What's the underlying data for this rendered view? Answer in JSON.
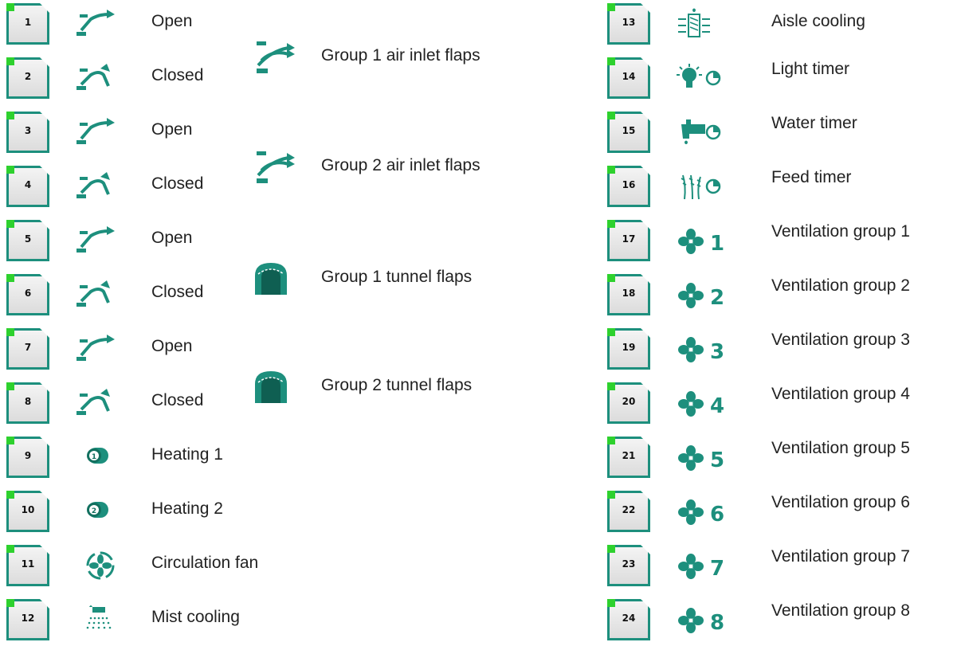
{
  "left_items": [
    {
      "num": "1",
      "label": "Open",
      "icon": "flap-open-icon"
    },
    {
      "num": "2",
      "label": "Closed",
      "icon": "flap-closed-icon"
    },
    {
      "num": "3",
      "label": "Open",
      "icon": "flap-open-icon"
    },
    {
      "num": "4",
      "label": "Closed",
      "icon": "flap-closed-icon"
    },
    {
      "num": "5",
      "label": "Open",
      "icon": "flap-open-icon"
    },
    {
      "num": "6",
      "label": "Closed",
      "icon": "flap-closed-icon"
    },
    {
      "num": "7",
      "label": "Open",
      "icon": "flap-open-icon"
    },
    {
      "num": "8",
      "label": "Closed",
      "icon": "flap-closed-icon"
    },
    {
      "num": "9",
      "label": "Heating 1",
      "icon": "heater-1-icon"
    },
    {
      "num": "10",
      "label": "Heating 2",
      "icon": "heater-2-icon"
    },
    {
      "num": "11",
      "label": "Circulation fan",
      "icon": "circulation-fan-icon"
    },
    {
      "num": "12",
      "label": "Mist cooling",
      "icon": "mist-cooling-icon"
    }
  ],
  "groups": [
    {
      "label": "Group 1 air inlet flaps",
      "icon": "air-inlet-flaps-icon"
    },
    {
      "label": "Group 2 air inlet flaps",
      "icon": "air-inlet-flaps-icon"
    },
    {
      "label": "Group 1 tunnel flaps",
      "icon": "tunnel-flaps-icon"
    },
    {
      "label": "Group 2 tunnel flaps",
      "icon": "tunnel-flaps-icon"
    }
  ],
  "right_items": [
    {
      "num": "13",
      "label": "Aisle cooling",
      "icon": "aisle-cooling-icon"
    },
    {
      "num": "14",
      "label": "Light timer",
      "icon": "light-timer-icon"
    },
    {
      "num": "15",
      "label": "Water timer",
      "icon": "water-timer-icon"
    },
    {
      "num": "16",
      "label": "Feed timer",
      "icon": "feed-timer-icon"
    },
    {
      "num": "17",
      "label": "Ventilation group 1",
      "icon": "fan-icon",
      "fan_number": "1"
    },
    {
      "num": "18",
      "label": "Ventilation group 2",
      "icon": "fan-icon",
      "fan_number": "2"
    },
    {
      "num": "19",
      "label": "Ventilation group 3",
      "icon": "fan-icon",
      "fan_number": "3"
    },
    {
      "num": "20",
      "label": "Ventilation group 4",
      "icon": "fan-icon",
      "fan_number": "4"
    },
    {
      "num": "21",
      "label": "Ventilation group 5",
      "icon": "fan-icon",
      "fan_number": "5"
    },
    {
      "num": "22",
      "label": "Ventilation group 6",
      "icon": "fan-icon",
      "fan_number": "6"
    },
    {
      "num": "23",
      "label": "Ventilation group 7",
      "icon": "fan-icon",
      "fan_number": "7"
    },
    {
      "num": "24",
      "label": "Ventilation group 8",
      "icon": "fan-icon",
      "fan_number": "8"
    }
  ],
  "colors": {
    "accent": "#1d8f7d",
    "led": "#2ed12e",
    "slot_bg": "#dcdcdc"
  }
}
